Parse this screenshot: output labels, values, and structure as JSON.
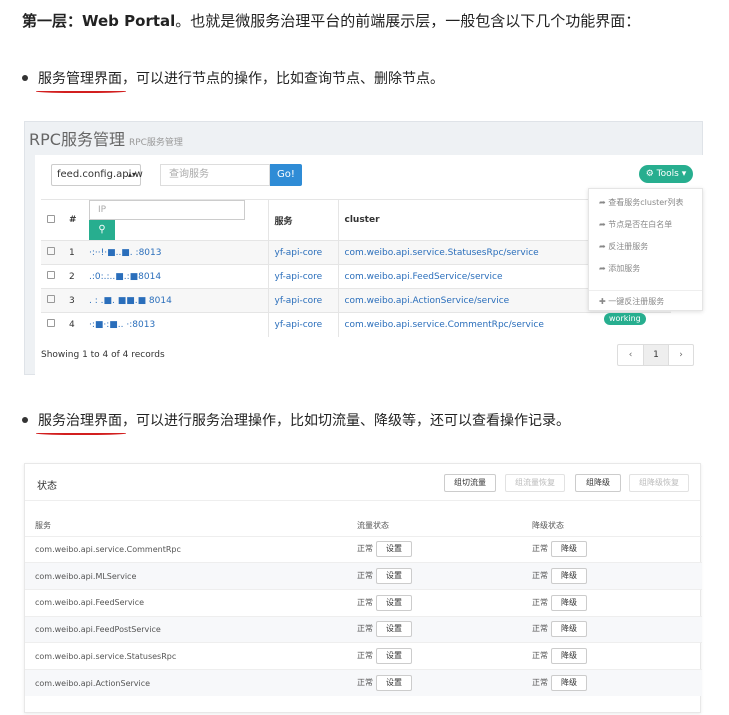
{
  "heading": {
    "bold_prefix": "第一层：Web Portal",
    "rest": "。也就是微服务治理平台的前端展示层，一般包含以下几个功能界面："
  },
  "bullet1": {
    "underlined": "服务管理界面",
    "rest": "，可以进行节点的操作，比如查询节点、删除节点。"
  },
  "bullet2": {
    "underlined": "服务治理界面",
    "rest": "，可以进行服务治理操作，比如切流量、降级等，还可以查看操作记录。"
  },
  "rpc_panel": {
    "title": "RPC服务管理",
    "subtitle": "RPC服务管理",
    "select_value": "feed.config.api.w",
    "search_placeholder": "查询服务",
    "go_label": "Go!",
    "tools_label": "⚙ Tools ▾",
    "columns": {
      "index": "#",
      "ip_placeholder": "IP",
      "service": "服务",
      "cluster": "cluster"
    },
    "rows": [
      {
        "idx": "1",
        "addr": "·:··!·■..■. :8013",
        "service": "yf-api-core",
        "cluster": "com.weibo.api.service.StatusesRpc/service"
      },
      {
        "idx": "2",
        "addr": ".:0:.:..■.:■8014",
        "service": "yf-api-core",
        "cluster": "com.weibo.api.FeedService/service"
      },
      {
        "idx": "3",
        "addr": ". : .■. ■■.■ 8014",
        "service": "yf-api-core",
        "cluster": "com.weibo.api.ActionService/service"
      },
      {
        "idx": "4",
        "addr": "·:■·:■.. ·:8013",
        "service": "yf-api-core",
        "cluster": "com.weibo.api.service.CommentRpc/service"
      }
    ],
    "menu": [
      "查看服务cluster列表",
      "节点是否在白名单",
      "反注册服务",
      "添加服务",
      "一键反注册服务"
    ],
    "status_badge": "working",
    "showing": "Showing 1 to 4 of 4 records",
    "pager": [
      "‹",
      "1",
      "›"
    ]
  },
  "gov_panel": {
    "title": "状态",
    "buttons": [
      "组切流量",
      "组流量恢复",
      "组降级",
      "组降级恢复"
    ],
    "columns": [
      "服务",
      "流量状态",
      "降级状态"
    ],
    "rows": [
      {
        "service": "com.weibo.api.service.CommentRpc",
        "flow": "正常",
        "flow_btn": "设置",
        "degrade": "正常",
        "degrade_btn": "降级"
      },
      {
        "service": "com.weibo.api.MLService",
        "flow": "正常",
        "flow_btn": "设置",
        "degrade": "正常",
        "degrade_btn": "降级"
      },
      {
        "service": "com.weibo.api.FeedService",
        "flow": "正常",
        "flow_btn": "设置",
        "degrade": "正常",
        "degrade_btn": "降级"
      },
      {
        "service": "com.weibo.api.FeedPostService",
        "flow": "正常",
        "flow_btn": "设置",
        "degrade": "正常",
        "degrade_btn": "降级"
      },
      {
        "service": "com.weibo.api.service.StatusesRpc",
        "flow": "正常",
        "flow_btn": "设置",
        "degrade": "正常",
        "degrade_btn": "降级"
      },
      {
        "service": "com.weibo.api.ActionService",
        "flow": "正常",
        "flow_btn": "设置",
        "degrade": "正常",
        "degrade_btn": "降级"
      }
    ]
  },
  "colors": {
    "accent_green": "#27ae8f",
    "accent_blue": "#2f8cd6",
    "underline_red": "#d21f1f"
  }
}
